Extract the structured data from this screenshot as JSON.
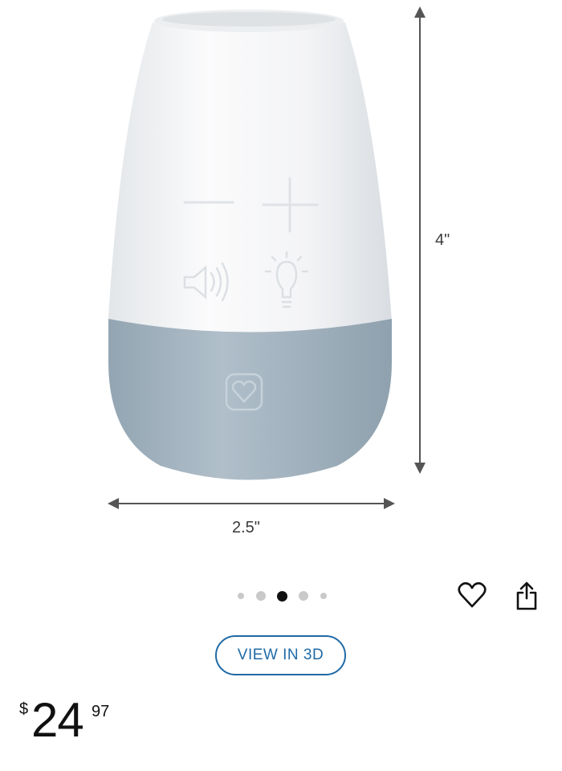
{
  "product": {
    "dimensions": {
      "height": "4\"",
      "width": "2.5\""
    },
    "colors": {
      "body": "#f5f6f7",
      "base": "#a8b8c4",
      "accent": "#1f6aa6"
    },
    "icons": [
      "minus-icon",
      "plus-icon",
      "volume-icon",
      "light-bulb-icon",
      "heart-logo-icon"
    ]
  },
  "carousel": {
    "total": 5,
    "active_index": 3
  },
  "actions": {
    "favorite_icon": "heart-outline-icon",
    "share_icon": "share-icon",
    "view3d_label": "VIEW IN 3D"
  },
  "price": {
    "symbol": "$",
    "whole": "24",
    "fraction": "97"
  }
}
